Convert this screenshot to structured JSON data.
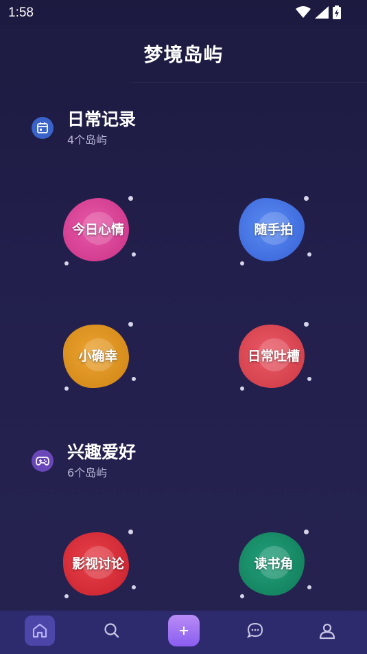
{
  "status": {
    "time": "1:58"
  },
  "header": {
    "title": "梦境岛屿"
  },
  "sections": [
    {
      "title": "日常记录",
      "subtitle": "4个岛屿",
      "icon": "calendar-icon",
      "icon_color": "#3a63c8",
      "islands": [
        {
          "label": "今日心情",
          "color": "#d23f8e"
        },
        {
          "label": "随手拍",
          "color": "#3f6fe0"
        },
        {
          "label": "小确幸",
          "color": "#d88c1c"
        },
        {
          "label": "日常吐槽",
          "color": "#d64250"
        }
      ]
    },
    {
      "title": "兴趣爱好",
      "subtitle": "6个岛屿",
      "icon": "gamepad-icon",
      "icon_color": "#6a47b8",
      "islands": [
        {
          "label": "影视讨论",
          "color": "#d12a35"
        },
        {
          "label": "读书角",
          "color": "#138560"
        }
      ]
    }
  ],
  "bottom_nav": {
    "items": [
      "home-icon",
      "search-icon",
      "add-icon",
      "chat-icon",
      "profile-icon"
    ],
    "active": "home-icon"
  }
}
